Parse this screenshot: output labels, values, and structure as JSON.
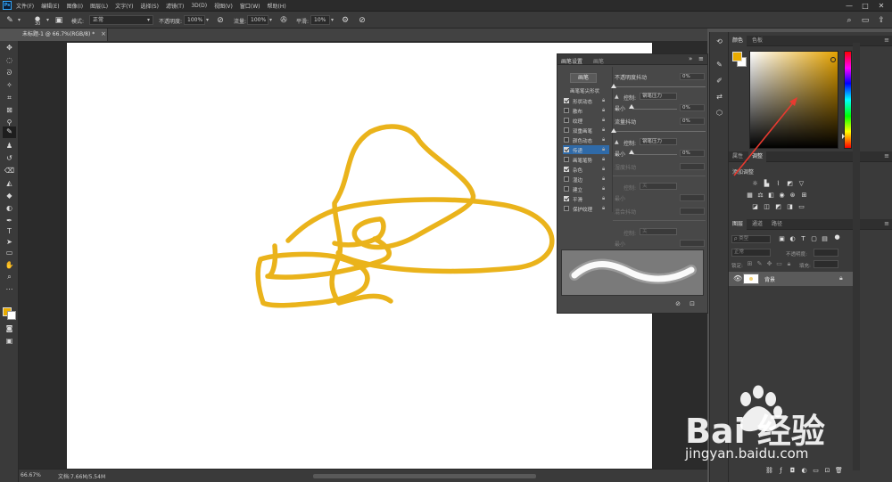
{
  "app": {
    "logo": "Ps",
    "menu": [
      "文件(F)",
      "编辑(E)",
      "图像(I)",
      "图层(L)",
      "文字(Y)",
      "选择(S)",
      "滤镜(T)",
      "3D(D)",
      "视图(V)",
      "窗口(W)",
      "帮助(H)"
    ],
    "window_controls": [
      "—",
      "□",
      "✕"
    ]
  },
  "options_bar": {
    "brush_size": "30",
    "mode_label": "模式:",
    "mode_value": "正常",
    "opacity_label": "不透明度:",
    "opacity_value": "100%",
    "flow_label": "流量:",
    "flow_value": "100%",
    "smoothing_label": "平滑:",
    "smoothing_value": "10%"
  },
  "document": {
    "tab_title": "未标题-1 @ 66.7%(RGB/8) *",
    "zoom": "66.67%",
    "doc_info": "文档:7.66M/5.54M"
  },
  "brush_panel": {
    "tabs": [
      "画笔设置",
      "画笔"
    ],
    "preset_button": "画笔",
    "tip_heading": "画笔笔尖形状",
    "options": [
      {
        "label": "形状动态",
        "checked": true
      },
      {
        "label": "散布",
        "checked": false
      },
      {
        "label": "纹理",
        "checked": false
      },
      {
        "label": "双重画笔",
        "checked": false
      },
      {
        "label": "颜色动态",
        "checked": false
      },
      {
        "label": "传递",
        "checked": true
      },
      {
        "label": "画笔笔势",
        "checked": false
      },
      {
        "label": "杂色",
        "checked": true
      },
      {
        "label": "湿边",
        "checked": false
      },
      {
        "label": "建立",
        "checked": false
      },
      {
        "label": "平滑",
        "checked": true
      },
      {
        "label": "保护纹理",
        "checked": false
      }
    ],
    "opacity_jitter_label": "不透明度抖动",
    "opacity_jitter_value": "0%",
    "control_label": "控制:",
    "pen_pressure": "钢笔压力",
    "minimum_label": "最小",
    "min_opacity_value": "0%",
    "flow_jitter_label": "流量抖动",
    "flow_jitter_value": "0%",
    "min_flow_value": "0%",
    "wetness_jitter_label": "湿度抖动",
    "off_value": "关",
    "mix_jitter_label": "混合抖动"
  },
  "color_panel": {
    "tabs": [
      "颜色",
      "色板"
    ],
    "foreground": "#e9ab00",
    "background": "#ffffff"
  },
  "adjust_panel": {
    "tabs": [
      "属性",
      "调整"
    ],
    "heading": "添加调整"
  },
  "layers_panel": {
    "tabs": [
      "图层",
      "通道",
      "路径"
    ],
    "filter_placeholder": "ρ 类型",
    "blend_mode": "正常",
    "opacity_label": "不透明度:",
    "lock_label": "锁定:",
    "fill_label": "填充:",
    "layer_name": "背景"
  },
  "canvas": {
    "stroke_color": "#eab31b"
  },
  "watermark": {
    "brand": "Bai 经验",
    "url": "jingyan.baidu.com"
  }
}
